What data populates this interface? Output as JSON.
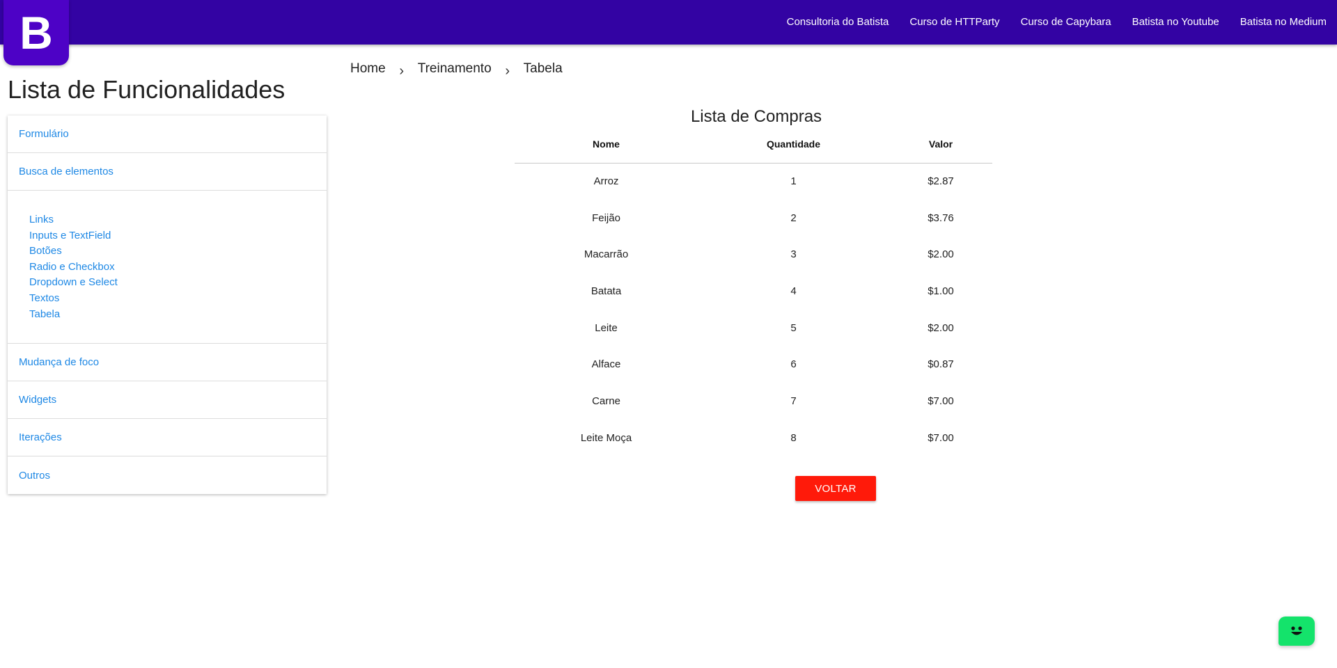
{
  "header": {
    "logo_letter": "B",
    "nav": [
      "Consultoria do Batista",
      "Curso de HTTParty",
      "Curso de Capybara",
      "Batista no Youtube",
      "Batista no Medium"
    ],
    "background_color": "#3303a3"
  },
  "breadcrumb": [
    "Home",
    "Treinamento",
    "Tabela"
  ],
  "sidebar": {
    "title": "Lista de Funcionalidades",
    "items": [
      "Formulário",
      "Busca de elementos",
      "Mudança de foco",
      "Widgets",
      "Iterações",
      "Outros"
    ],
    "subitems": [
      "Links",
      "Inputs e TextField",
      "Botões",
      "Radio e Checkbox",
      "Dropdown e Select",
      "Textos",
      "Tabela"
    ],
    "link_color": "#1e88e5"
  },
  "table": {
    "title": "Lista de Compras",
    "headers": [
      "Nome",
      "Quantidade",
      "Valor"
    ],
    "rows": [
      [
        "Arroz",
        "1",
        "$2.87"
      ],
      [
        "Feijão",
        "2",
        "$3.76"
      ],
      [
        "Macarrão",
        "3",
        "$2.00"
      ],
      [
        "Batata",
        "4",
        "$1.00"
      ],
      [
        "Leite",
        "5",
        "$2.00"
      ],
      [
        "Alface",
        "6",
        "$0.87"
      ],
      [
        "Carne",
        "7",
        "$7.00"
      ],
      [
        "Leite Moça",
        "8",
        "$7.00"
      ]
    ]
  },
  "actions": {
    "back_label": "VOLTAR",
    "back_color": "#ff1a0a"
  },
  "chat": {
    "icon": "chat-bot-icon",
    "color": "#14e36b"
  }
}
